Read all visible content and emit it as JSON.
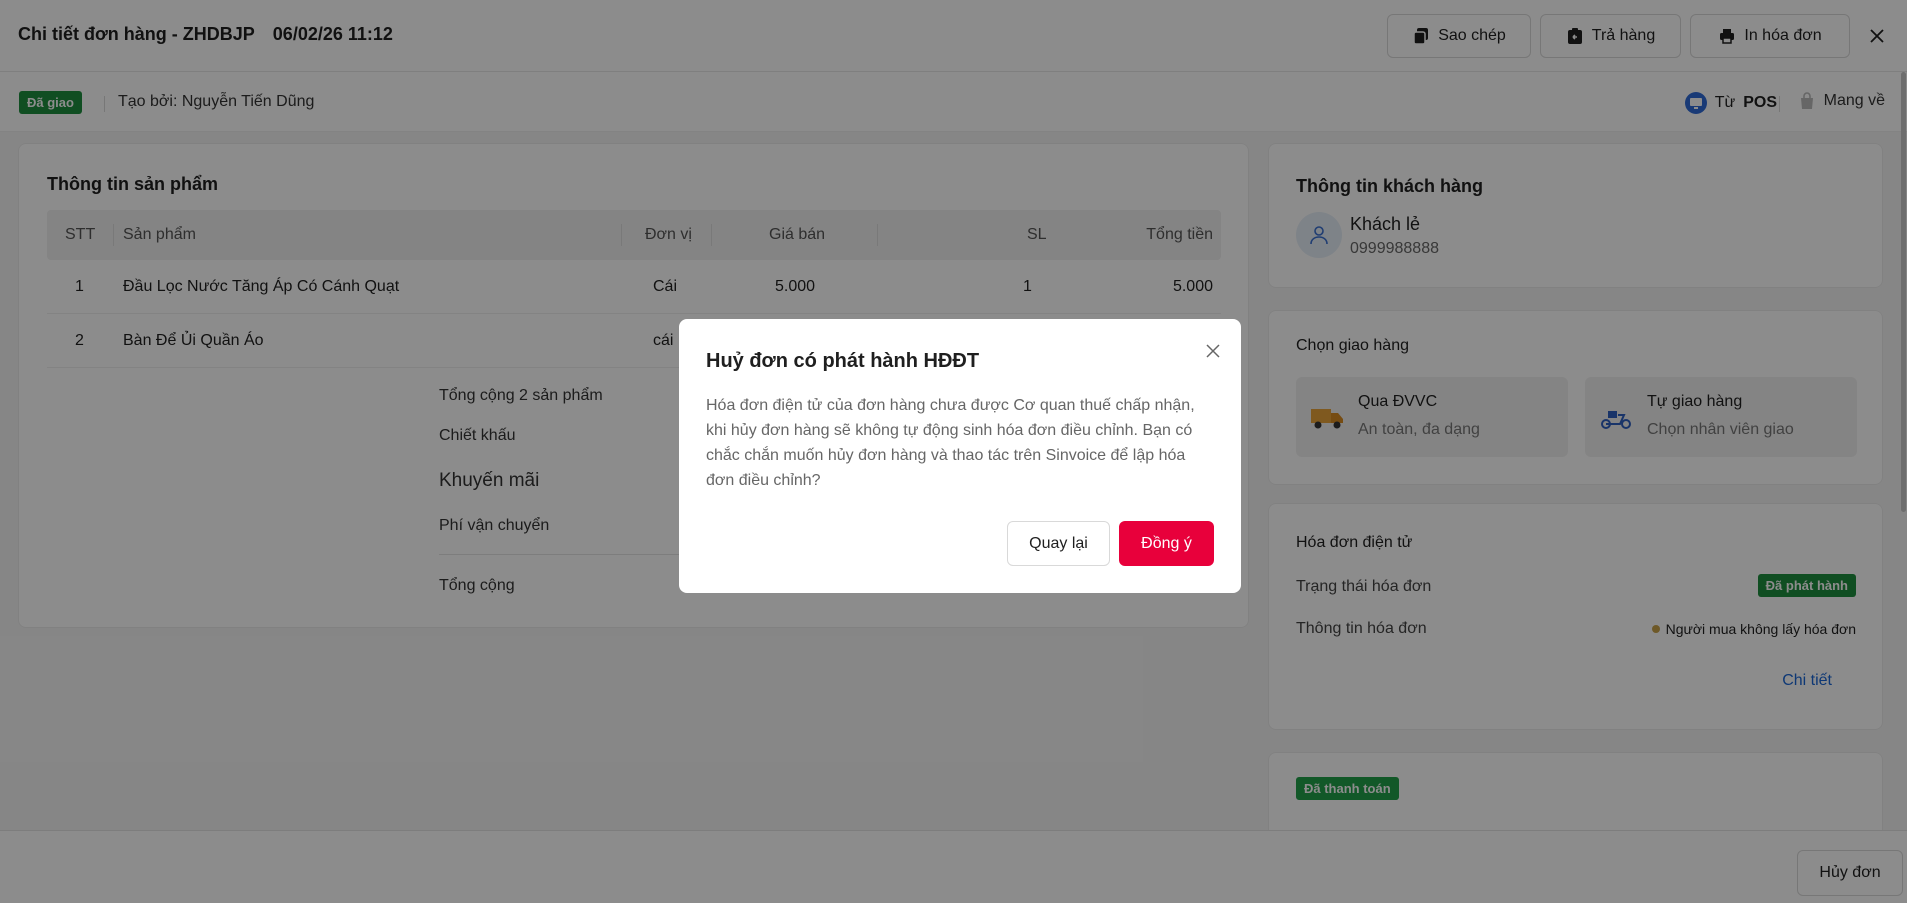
{
  "header": {
    "title": "Chi tiết đơn hàng - ZHDBJP",
    "datetime": "06/02/26 11:12",
    "copy_label": "Sao chép",
    "return_label": "Trả hàng",
    "print_label": "In hóa đơn"
  },
  "status": {
    "badge": "Đã giao",
    "creator": "Tạo bởi: Nguyễn Tiến Dũng",
    "source_prefix": "Từ",
    "source": "POS",
    "takeaway": "Mang về"
  },
  "products": {
    "title": "Thông tin sản phẩm",
    "columns": [
      "STT",
      "Sản phẩm",
      "Đơn vị",
      "Giá bán",
      "SL",
      "Tổng tiền"
    ],
    "rows": [
      {
        "stt": "1",
        "name": "Đầu Lọc Nước Tăng Áp Có Cánh Quạt",
        "unit": "Cái",
        "price": "5.000",
        "qty": "1",
        "total": "5.000"
      },
      {
        "stt": "2",
        "name": "Bàn Để Ủi Quần Áo",
        "unit": "cái",
        "price": "",
        "qty": "",
        "total": ""
      }
    ],
    "summary": {
      "count_label": "Tổng cộng 2 sản phẩm",
      "discount_label": "Chiết khấu",
      "promo_label": "Khuyến mãi",
      "shipping_label": "Phí vận chuyển",
      "total_label": "Tổng cộng"
    }
  },
  "customer": {
    "title": "Thông tin khách hàng",
    "name": "Khách lẻ",
    "phone": "0999988888"
  },
  "shipping": {
    "title": "Chọn giao hàng",
    "options": [
      {
        "title": "Qua ĐVVC",
        "subtitle": "An toàn, đa dạng"
      },
      {
        "title": "Tự giao hàng",
        "subtitle": "Chọn nhân viên giao"
      }
    ]
  },
  "einvoice": {
    "title": "Hóa đơn điện tử",
    "status_label": "Trạng thái hóa đơn",
    "status_badge": "Đã phát hành",
    "info_label": "Thông tin hóa đơn",
    "info_value": "Người mua không lấy hóa đơn",
    "detail_link": "Chi tiết"
  },
  "payment": {
    "badge": "Đã thanh toán"
  },
  "footer": {
    "cancel_label": "Hủy đơn"
  },
  "modal": {
    "title": "Huỷ đơn có phát hành HĐĐT",
    "body": "Hóa đơn điện tử của đơn hàng chưa được Cơ quan thuế chấp nhận, khi hủy đơn hàng sẽ không tự động sinh hóa đơn điều chỉnh. Bạn có chắc chắn muốn hủy đơn hàng và thao tác trên Sinvoice để lập hóa đơn điều chỉnh?",
    "back_label": "Quay lại",
    "confirm_label": "Đồng ý"
  },
  "colors": {
    "success": "#1e8e3e",
    "danger": "#e8003b",
    "link": "#1a66d6"
  }
}
